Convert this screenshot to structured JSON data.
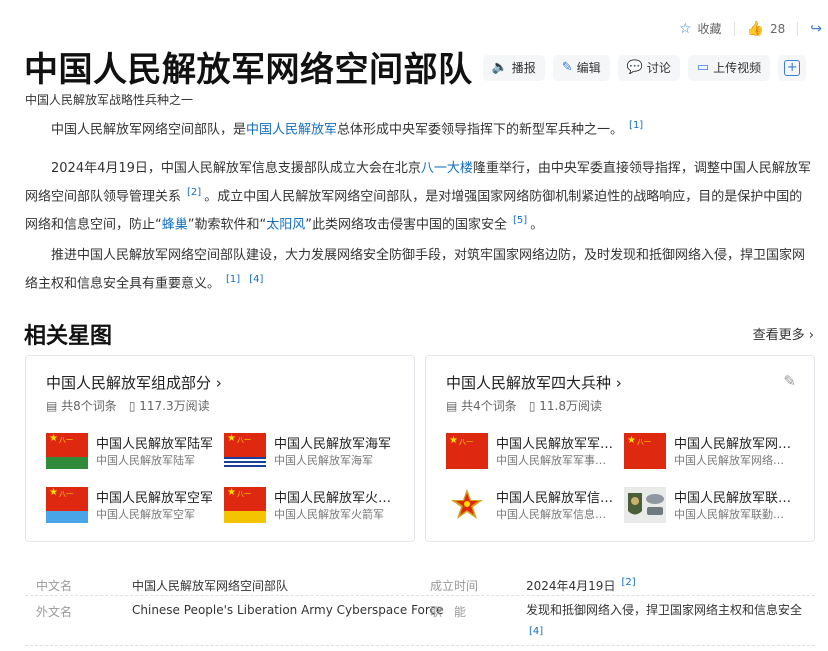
{
  "toolbar": {
    "collect_label": "收藏",
    "like_count": "28"
  },
  "header": {
    "title": "中国人民解放军网络空间部队",
    "actions": {
      "broadcast": "播报",
      "edit": "编辑",
      "discuss": "讨论",
      "upload_video": "上传视频",
      "add": "+"
    },
    "subtitle": "中国人民解放军战略性兵种之一"
  },
  "paragraphs": {
    "p1": {
      "before": "中国人民解放军网络空间部队，是",
      "link1": "中国人民解放军",
      "after": "总体形成中央军委领导指挥下的新型军兵种之一。",
      "ref": "[1]"
    },
    "p2": {
      "before": "2024年4月19日，中国人民解放军信息支援部队成立大会在北京",
      "link1": "八一大楼",
      "mid1": "隆重举行，由中央军委直接领导指挥，调整中国人民解放军网络空间部队领导管理关系",
      "ref1": "[2]",
      "mid2": "。成立中国人民解放军网络空间部队，是对增强国家网络防御机制紧迫性的战略响应，目的是保护中国的网络和信息空间，防止“",
      "link2": "蜂巢",
      "mid3": "”勒索软件和“",
      "link3": "太阳风",
      "mid4": "”此类网络攻击侵害中国的国家安全",
      "ref2": "[5]",
      "end": "。"
    },
    "p3": {
      "text": "推进中国人民解放军网络空间部队建设，大力发展网络安全防御手段，对筑牢国家网络边防，及时发现和抵御网络入侵，捍卫国家网络主权和信息安全具有重要意义。",
      "ref1": "[1]",
      "ref2": "[4]"
    }
  },
  "related": {
    "title": "相关星图",
    "see_more": "查看更多",
    "cards": [
      {
        "title": "中国人民解放军组成部分",
        "entry_count": "共8个词条",
        "reads": "117.3万阅读",
        "items": [
          {
            "title": "中国人民解放军陆军",
            "subtitle": "中国人民解放军陆军"
          },
          {
            "title": "中国人民解放军海军",
            "subtitle": "中国人民解放军海军"
          },
          {
            "title": "中国人民解放军空军",
            "subtitle": "中国人民解放军空军"
          },
          {
            "title": "中国人民解放军火箭军",
            "subtitle": "中国人民解放军火箭军"
          }
        ]
      },
      {
        "title": "中国人民解放军四大兵种",
        "entry_count": "共4个词条",
        "reads": "11.8万阅读",
        "items": [
          {
            "title": "中国人民解放军军事航天部队",
            "subtitle": "中国人民解放军军事航天部队"
          },
          {
            "title": "中国人民解放军网络空间部队",
            "subtitle": "中国人民解放军网络空间部队"
          },
          {
            "title": "中国人民解放军信息支援部队",
            "subtitle": "中国人民解放军信息支援部队"
          },
          {
            "title": "中国人民解放军联勤保障部队",
            "subtitle": "中国人民解放军联勤保障部队"
          }
        ]
      }
    ]
  },
  "infobox": {
    "chinese_name_label": "中文名",
    "chinese_name_value": "中国人民解放军网络空间部队",
    "founded_label": "成立时间",
    "founded_value": "2024年4月19日",
    "founded_ref": "[2]",
    "english_name_label": "外文名",
    "english_name_value": "Chinese People's Liberation Army Cyberspace Force",
    "function_label": "职　能",
    "function_value": "发现和抵御网络入侵，捍卫国家网络主权和信息安全",
    "function_ref": "[4]"
  },
  "colors": {
    "link": "#136ec2",
    "accent": "#3a7fd5",
    "flag_red": "#de2910"
  }
}
